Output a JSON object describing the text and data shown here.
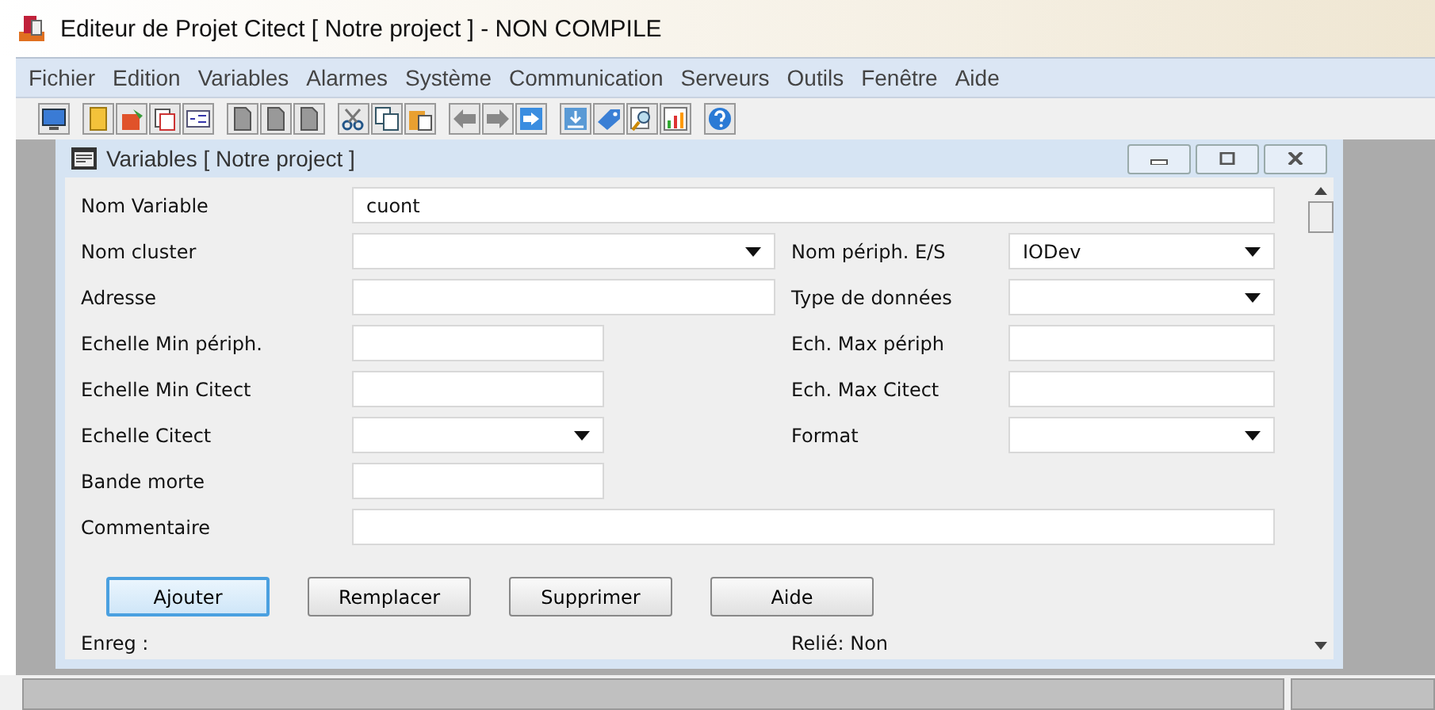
{
  "window": {
    "title": "Editeur de Projet Citect [ Notre project ] - NON COMPILE"
  },
  "menu": [
    "Fichier",
    "Edition",
    "Variables",
    "Alarmes",
    "Système",
    "Communication",
    "Serveurs",
    "Outils",
    "Fenêtre",
    "Aide"
  ],
  "child": {
    "title": "Variables [ Notre project ]"
  },
  "rows": [
    {
      "label": "Nom Variable",
      "value": "cuont",
      "kind": "text"
    },
    {
      "label": "Nom cluster",
      "kind": "combo",
      "right": {
        "label": "Nom périph. E/S",
        "value": "IODev",
        "kind": "combo"
      }
    },
    {
      "label": "Adresse",
      "kind": "text",
      "right": {
        "label": "Type de données",
        "kind": "combo"
      }
    },
    {
      "label": "Echelle Min périph.",
      "kind": "text",
      "right": {
        "label": "Ech. Max périph",
        "kind": "text"
      }
    },
    {
      "label": "Echelle Min Citect",
      "kind": "text",
      "right": {
        "label": "Ech. Max Citect",
        "kind": "text"
      }
    },
    {
      "label": "Echelle Citect",
      "kind": "combo",
      "right": {
        "label": "Format",
        "kind": "combo"
      }
    },
    {
      "label": "Bande morte",
      "kind": "text"
    },
    {
      "label": "Commentaire",
      "kind": "text"
    }
  ],
  "buttons": [
    {
      "label": "Ajouter",
      "selected": true
    },
    {
      "label": "Remplacer",
      "selected": false
    },
    {
      "label": "Supprimer",
      "selected": false
    },
    {
      "label": "Aide",
      "selected": false
    }
  ],
  "footer": {
    "left": "Enreg :",
    "right": "Relié: Non"
  }
}
